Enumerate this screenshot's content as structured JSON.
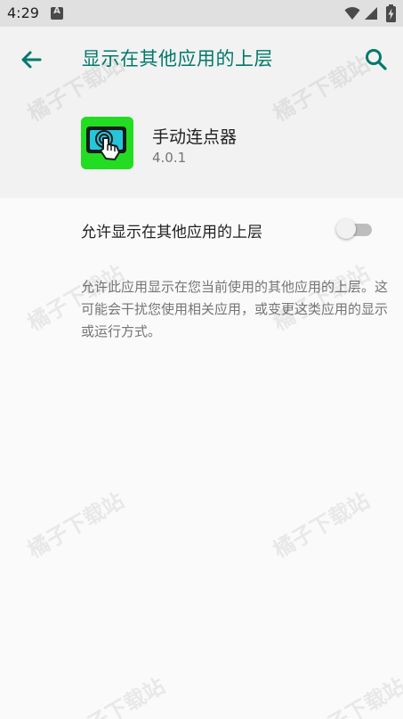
{
  "status_bar": {
    "time": "4:29",
    "icons": [
      "notification-a-icon",
      "wifi-icon",
      "signal-icon",
      "battery-charging-icon"
    ]
  },
  "app_bar": {
    "title": "显示在其他应用的上层",
    "back_icon": "arrow-back-icon",
    "search_icon": "search-icon"
  },
  "app_info": {
    "name": "手动连点器",
    "version": "4.0.1",
    "icon": "tap-screen-icon"
  },
  "setting": {
    "label": "允许显示在其他应用的上层",
    "enabled": false
  },
  "description": "允许此应用显示在您当前使用的其他应用的上层。这可能会干扰您使用相关应用，或变更这类应用的显示或运行方式。",
  "watermark": "橘子下载站",
  "colors": {
    "accent": "#00796b",
    "status_bar_bg": "#e0e0e0",
    "header_bg": "#f2f2f2",
    "page_bg": "#fafafa",
    "app_icon_green": "#22dd22"
  }
}
